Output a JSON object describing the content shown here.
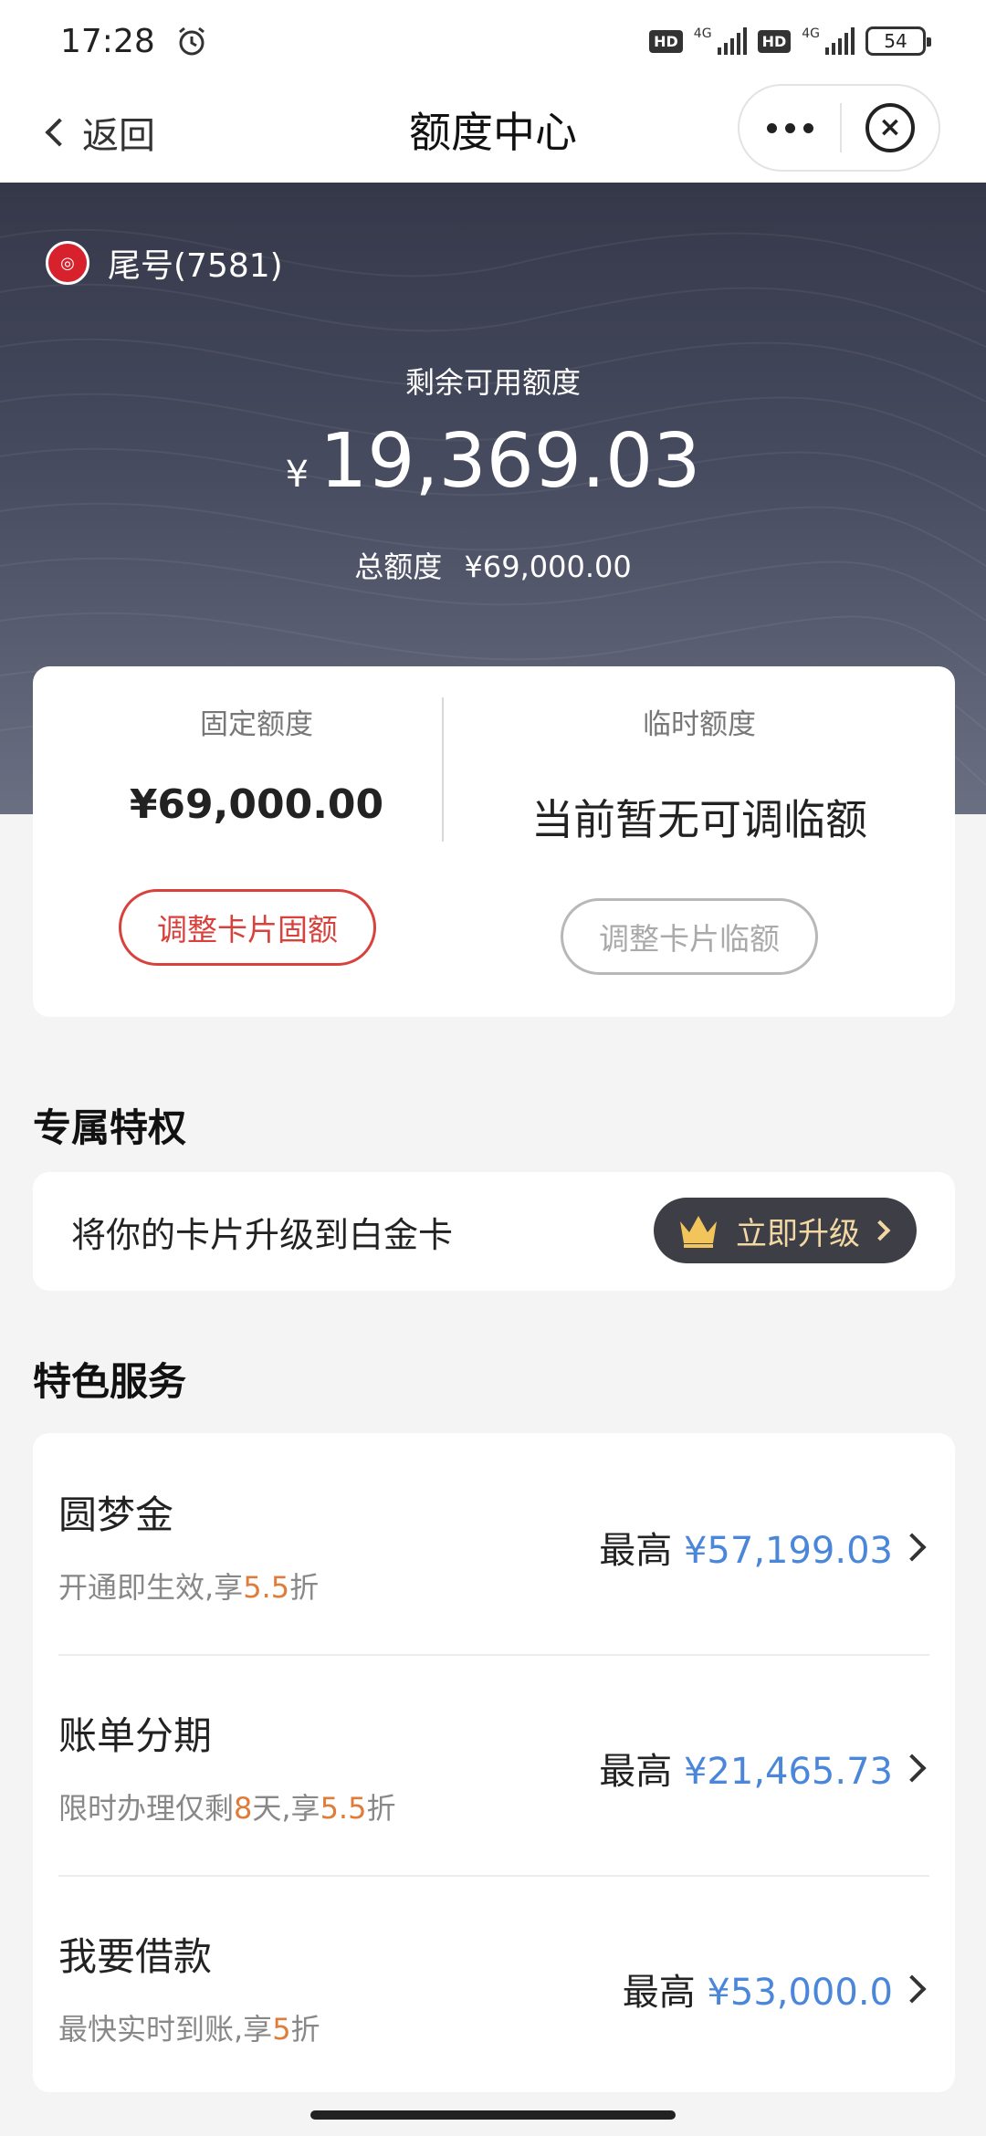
{
  "status_bar": {
    "time": "17:28",
    "hd1": "HD",
    "net1": "4G",
    "hd2": "HD",
    "net2": "4G",
    "battery": "54"
  },
  "nav": {
    "back_label": "返回",
    "title": "额度中心"
  },
  "header": {
    "card_tail": "尾号(7581)",
    "remaining_label": "剩余可用额度",
    "currency": "¥",
    "remaining_value": "19,369.03",
    "total_label": "总额度",
    "total_value": "¥69,000.00"
  },
  "limits": {
    "fixed_label": "固定额度",
    "fixed_value": "¥69,000.00",
    "fixed_button": "调整卡片固额",
    "temp_label": "临时额度",
    "temp_value": "当前暂无可调临额",
    "temp_button": "调整卡片临额"
  },
  "privilege": {
    "section_title": "专属特权",
    "text": "将你的卡片升级到白金卡",
    "button": "立即升级"
  },
  "services": {
    "section_title": "特色服务",
    "max_prefix": "最高",
    "items": [
      {
        "name": "圆梦金",
        "desc_a": "开通即生效,享",
        "desc_hl1": "5.5",
        "desc_b": "折",
        "desc_hl2": "",
        "desc_c": "",
        "amount": "¥57,199.03"
      },
      {
        "name": "账单分期",
        "desc_a": "限时办理仅剩",
        "desc_hl1": "8",
        "desc_b": "天,享",
        "desc_hl2": "5.5",
        "desc_c": "折",
        "amount": "¥21,465.73"
      },
      {
        "name": "我要借款",
        "desc_a": "最快实时到账,享",
        "desc_hl1": "5",
        "desc_b": "折",
        "desc_hl2": "",
        "desc_c": "",
        "amount": "¥53,000.0"
      }
    ]
  },
  "colors": {
    "accent_red": "#d9423c",
    "highlight_orange": "#e07c3a",
    "amount_blue": "#4a86d9",
    "banner_dark": "#343849"
  }
}
